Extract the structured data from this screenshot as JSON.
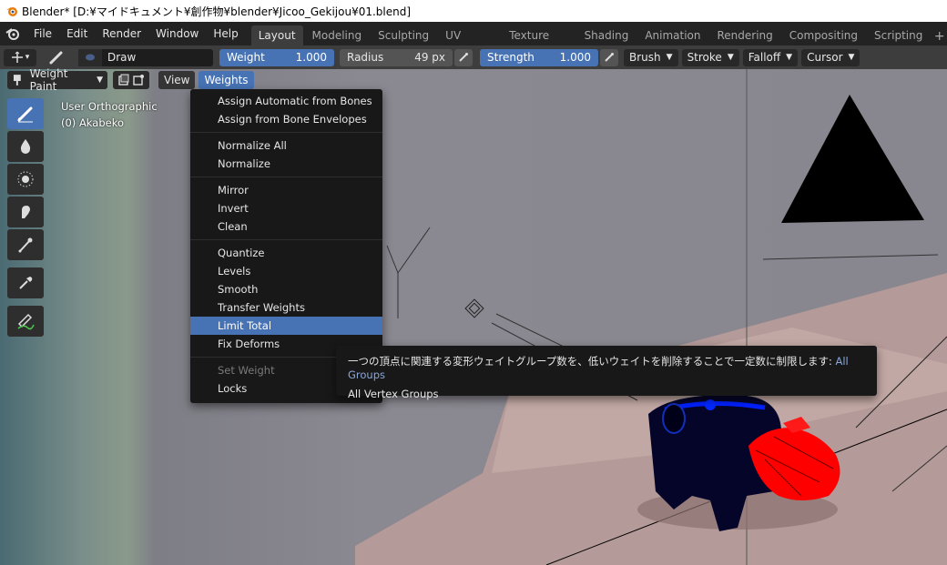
{
  "window": {
    "title": "Blender* [D:¥マイドキュメント¥創作物¥blender¥Jicoo_Gekijou¥01.blend]"
  },
  "menubar": {
    "items": [
      "File",
      "Edit",
      "Render",
      "Window",
      "Help"
    ]
  },
  "workspaces": {
    "tabs": [
      "Layout",
      "Modeling",
      "Sculpting",
      "UV Editing",
      "Texture Paint",
      "Shading",
      "Animation",
      "Rendering",
      "Compositing",
      "Scripting"
    ],
    "active": "Layout",
    "add_label": "+"
  },
  "tool_settings": {
    "brush_name": "Draw",
    "weight_label": "Weight",
    "weight_value": "1.000",
    "radius_label": "Radius",
    "radius_value": "49 px",
    "strength_label": "Strength",
    "strength_value": "1.000",
    "dropdowns": [
      "Brush",
      "Stroke",
      "Falloff",
      "Cursor"
    ]
  },
  "viewport_header": {
    "mode": "Weight Paint",
    "menus": [
      "View",
      "Weights"
    ],
    "open_menu": "Weights"
  },
  "viewport": {
    "view_name": "User Orthographic",
    "object_name": "(0) Akabeko"
  },
  "weights_menu": {
    "groups": [
      [
        "Assign Automatic from Bones",
        "Assign from Bone Envelopes"
      ],
      [
        "Normalize All",
        "Normalize"
      ],
      [
        "Mirror",
        "Invert",
        "Clean"
      ],
      [
        "Quantize",
        "Levels",
        "Smooth",
        "Transfer Weights",
        "Limit Total",
        "Fix Deforms"
      ],
      [
        "Set Weight",
        "Locks"
      ]
    ],
    "highlighted": "Limit Total",
    "disabled": [
      "Set Weight"
    ]
  },
  "tooltip": {
    "description": "一つの頂点に関連する変形ウェイトグループ数を、低いウェイトを削除することで一定数に制限します:",
    "current_value": "All Groups",
    "line2": "All Vertex Groups"
  },
  "colors": {
    "accent": "#4772b3",
    "menu_bg": "#181818",
    "header_bg": "#3d3d3d",
    "weight_red": "#ff0000",
    "weight_blue": "#0000cc"
  }
}
